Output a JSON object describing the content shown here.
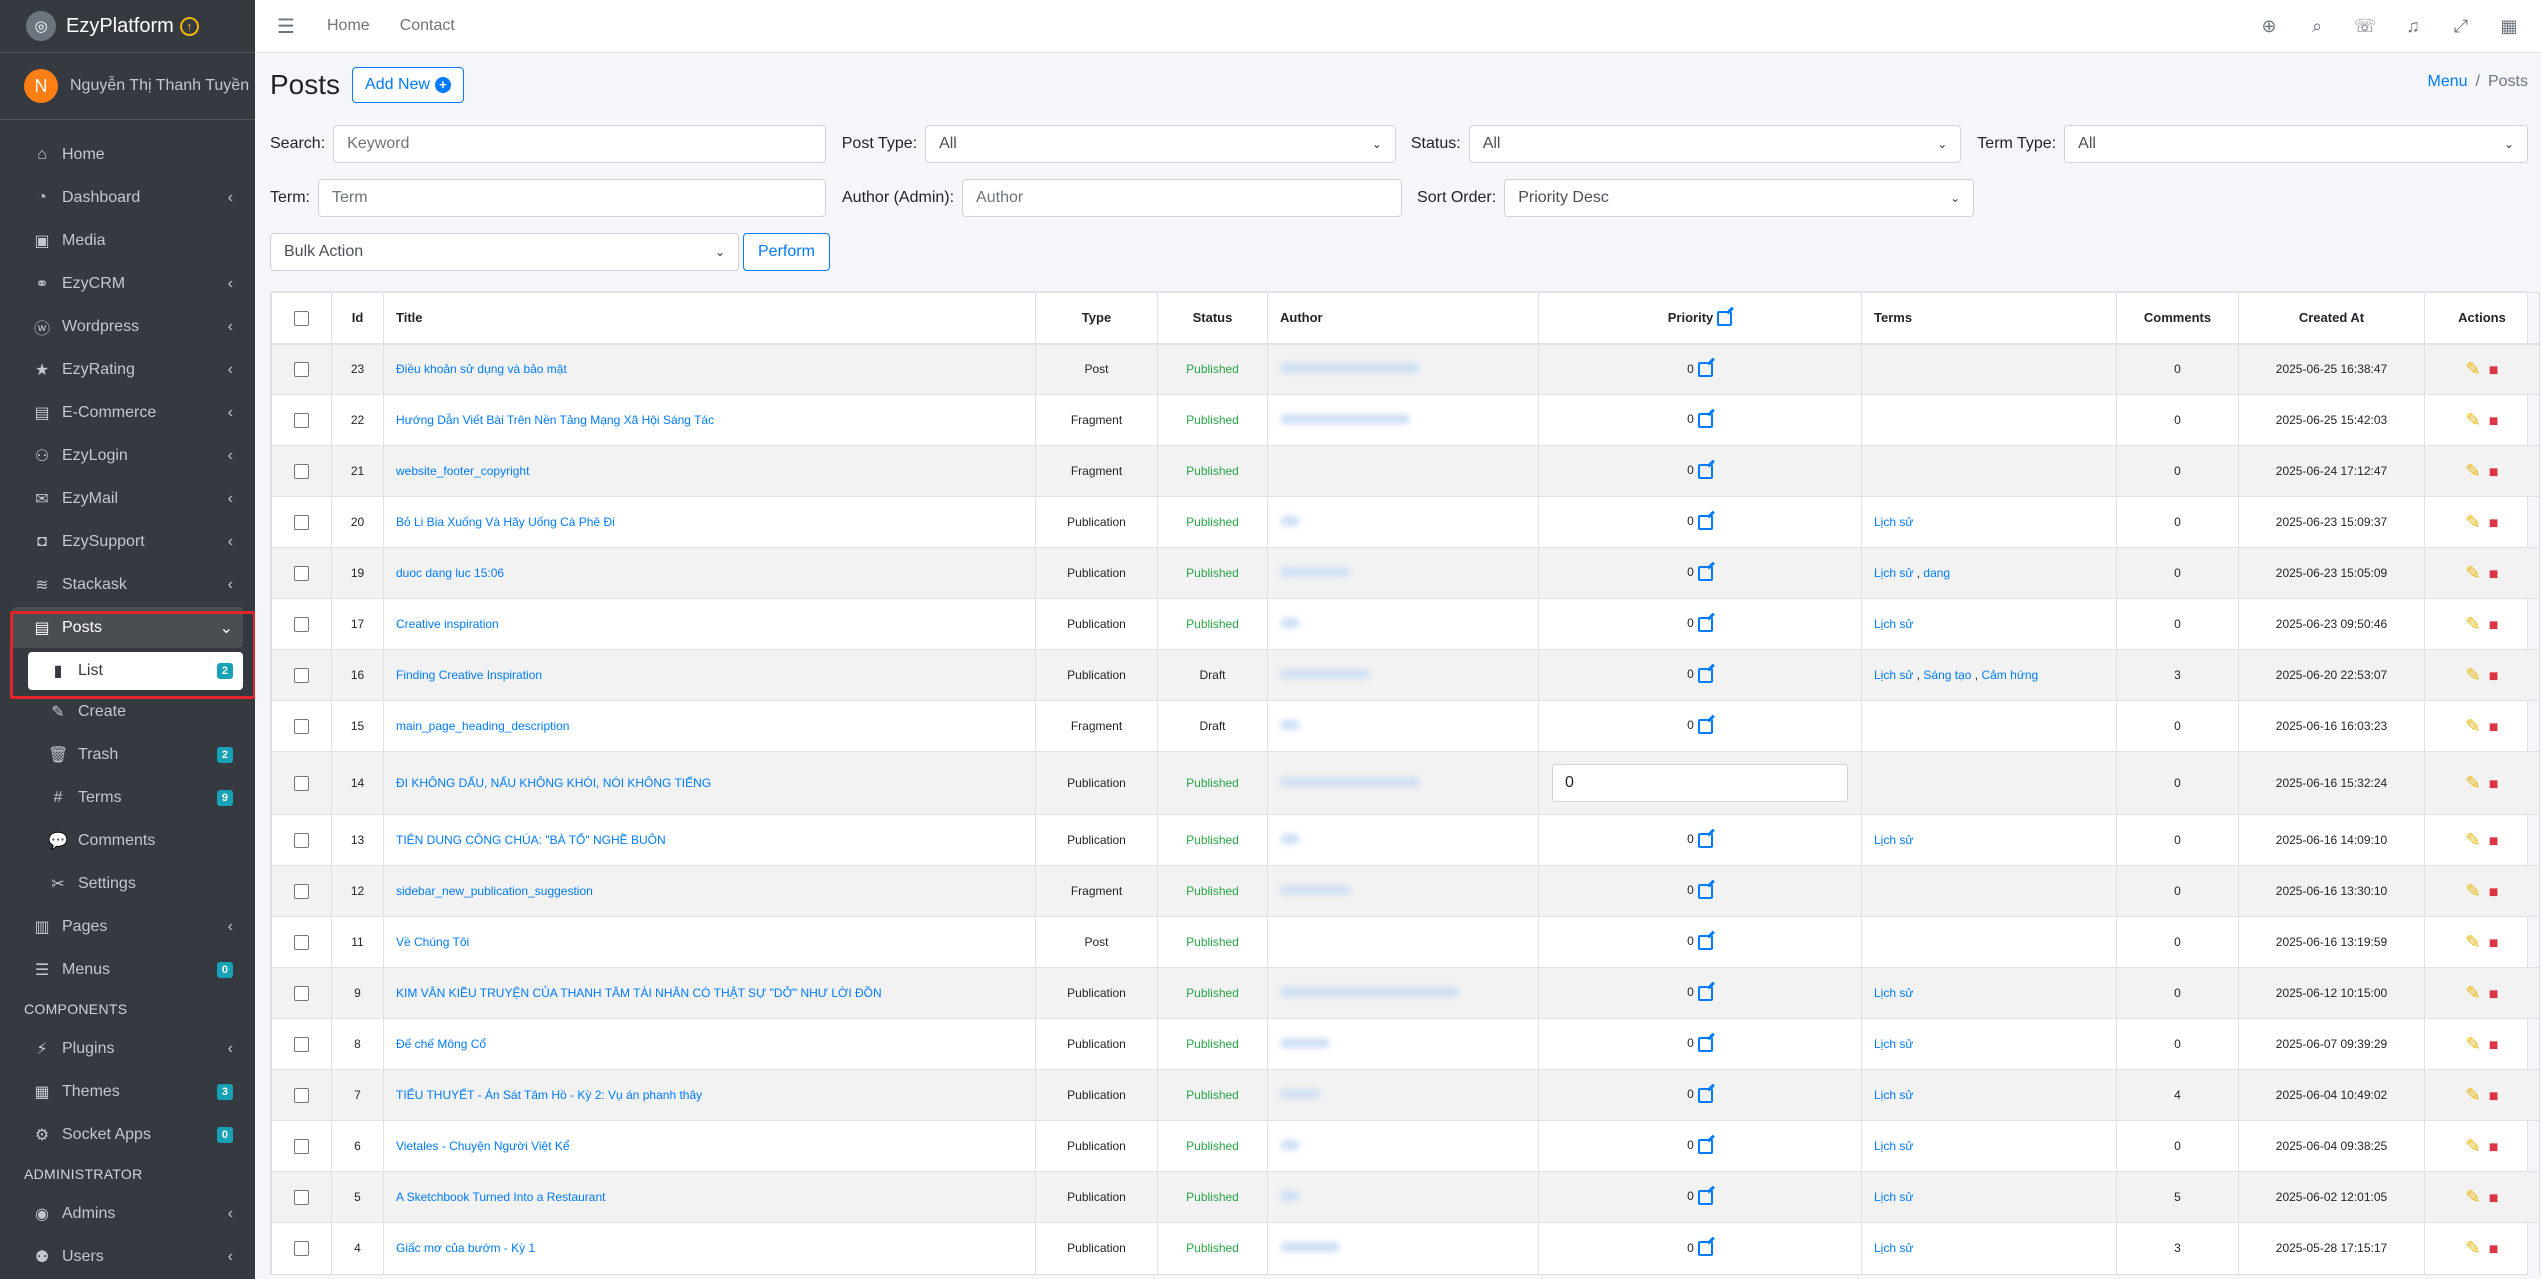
{
  "brand": {
    "name": "EzyPlatform",
    "badge": "↑"
  },
  "user": {
    "initial": "N",
    "name": "Nguyễn Thị Thanh Tuyền"
  },
  "sidebar": {
    "items": [
      {
        "label": "Home",
        "icon": "home-icon",
        "glyph": "⌂",
        "chevron": ""
      },
      {
        "label": "Dashboard",
        "icon": "dashboard-icon",
        "glyph": "◔",
        "chevron": "‹"
      },
      {
        "label": "Media",
        "icon": "image-icon",
        "glyph": "▣",
        "chevron": ""
      },
      {
        "label": "EzyCRM",
        "icon": "handshake-icon",
        "glyph": "⚭",
        "chevron": "‹"
      },
      {
        "label": "Wordpress",
        "icon": "wordpress-icon",
        "glyph": "ⓦ",
        "chevron": "‹"
      },
      {
        "label": "EzyRating",
        "icon": "star-icon",
        "glyph": "★",
        "chevron": "‹"
      },
      {
        "label": "E-Commerce",
        "icon": "shop-icon",
        "glyph": "▤",
        "chevron": "‹"
      },
      {
        "label": "EzyLogin",
        "icon": "user-login-icon",
        "glyph": "⚇",
        "chevron": "‹"
      },
      {
        "label": "EzyMail",
        "icon": "mail-icon",
        "glyph": "✉",
        "chevron": "‹"
      },
      {
        "label": "EzySupport",
        "icon": "support-icon",
        "glyph": "◘",
        "chevron": "‹"
      },
      {
        "label": "Stackask",
        "icon": "layers-icon",
        "glyph": "≋",
        "chevron": "‹"
      }
    ],
    "posts": {
      "label": "Posts",
      "chevron": "⌄"
    },
    "posts_sub": [
      {
        "label": "List",
        "badge": "2",
        "icon": "book-icon",
        "glyph": "▮"
      },
      {
        "label": "Create",
        "badge": "",
        "icon": "edit-icon",
        "glyph": "✎"
      },
      {
        "label": "Trash",
        "badge": "2",
        "icon": "trash-icon",
        "glyph": "🗑"
      },
      {
        "label": "Terms",
        "badge": "9",
        "icon": "hashtag-icon",
        "glyph": "#"
      },
      {
        "label": "Comments",
        "badge": "",
        "icon": "comments-icon",
        "glyph": "💬"
      },
      {
        "label": "Settings",
        "badge": "",
        "icon": "tools-icon",
        "glyph": "✂"
      }
    ],
    "after_posts": [
      {
        "label": "Pages",
        "icon": "book-open-icon",
        "glyph": "▥",
        "chevron": "‹",
        "badge": ""
      },
      {
        "label": "Menus",
        "icon": "menu-icon",
        "glyph": "☰",
        "chevron": "",
        "badge": "0"
      }
    ],
    "components_header": "COMPONENTS",
    "components": [
      {
        "label": "Plugins",
        "icon": "plug-icon",
        "glyph": "⚡",
        "chevron": "‹",
        "badge": ""
      },
      {
        "label": "Themes",
        "icon": "themes-icon",
        "glyph": "▦",
        "chevron": "",
        "badge": "3"
      },
      {
        "label": "Socket Apps",
        "icon": "socket-icon",
        "glyph": "⚙",
        "chevron": "",
        "badge": "0"
      }
    ],
    "admin_header": "ADMINISTRATOR",
    "admin": [
      {
        "label": "Admins",
        "icon": "admin-icon",
        "glyph": "◉",
        "chevron": "‹",
        "badge": ""
      },
      {
        "label": "Users",
        "icon": "users-icon",
        "glyph": "⚉",
        "chevron": "‹",
        "badge": ""
      }
    ]
  },
  "topbar": {
    "home": "Home",
    "contact": "Contact"
  },
  "page": {
    "title": "Posts",
    "add_new": "Add New"
  },
  "breadcrumb": {
    "menu": "Menu",
    "current": "Posts"
  },
  "filters": {
    "search_label": "Search:",
    "search_placeholder": "Keyword",
    "post_type_label": "Post Type:",
    "post_type_value": "All",
    "status_label": "Status:",
    "status_value": "All",
    "term_type_label": "Term Type:",
    "term_type_value": "All",
    "term_label": "Term:",
    "term_placeholder": "Term",
    "author_label": "Author (Admin):",
    "author_placeholder": "Author",
    "sort_label": "Sort Order:",
    "sort_value": "Priority Desc",
    "bulk_value": "Bulk Action",
    "perform": "Perform"
  },
  "table": {
    "headers": {
      "id": "Id",
      "title": "Title",
      "type": "Type",
      "status": "Status",
      "author": "Author",
      "priority": "Priority",
      "terms": "Terms",
      "comments": "Comments",
      "created": "Created At",
      "actions": "Actions"
    },
    "rows": [
      {
        "id": "23",
        "title": "Điều khoản sử dụng và bảo mật",
        "type": "Post",
        "status": "Published",
        "priority": "0",
        "terms": "",
        "comments": "0",
        "created": "2025-06-25 16:38:47"
      },
      {
        "id": "22",
        "title": "Hướng Dẫn Viết Bài Trên Nền Tảng Mạng Xã Hội Sáng Tác",
        "type": "Fragment",
        "status": "Published",
        "priority": "0",
        "terms": "",
        "comments": "0",
        "created": "2025-06-25 15:42:03"
      },
      {
        "id": "21",
        "title": "website_footer_copyright",
        "type": "Fragment",
        "status": "Published",
        "priority": "0",
        "terms": "",
        "comments": "0",
        "created": "2025-06-24 17:12:47"
      },
      {
        "id": "20",
        "title": "Bỏ Li Bia Xuống Và Hãy Uống Cà Phê Đi",
        "type": "Publication",
        "status": "Published",
        "priority": "0",
        "terms": "Lịch sử",
        "comments": "0",
        "created": "2025-06-23 15:09:37"
      },
      {
        "id": "19",
        "title": "duoc dang luc 15:06",
        "type": "Publication",
        "status": "Published",
        "priority": "0",
        "terms": "Lịch sử , dang",
        "comments": "0",
        "created": "2025-06-23 15:05:09"
      },
      {
        "id": "17",
        "title": "Creative inspiration",
        "type": "Publication",
        "status": "Published",
        "priority": "0",
        "terms": "Lịch sử",
        "comments": "0",
        "created": "2025-06-23 09:50:46"
      },
      {
        "id": "16",
        "title": "Finding Creative Inspiration",
        "type": "Publication",
        "status": "Draft",
        "priority": "0",
        "terms": "Lịch sử , Sáng tạo , Cảm hứng",
        "comments": "3",
        "created": "2025-06-20 22:53:07"
      },
      {
        "id": "15",
        "title": "main_page_heading_description",
        "type": "Fragment",
        "status": "Draft",
        "priority": "0",
        "terms": "",
        "comments": "0",
        "created": "2025-06-16 16:03:23"
      },
      {
        "id": "14",
        "title": "ĐI KHÔNG DẤU, NẤU KHÔNG KHÓI, NÓI KHÔNG TIẾNG",
        "type": "Publication",
        "status": "Published",
        "priority": "0",
        "terms": "",
        "comments": "0",
        "created": "2025-06-16 15:32:24",
        "editing": true
      },
      {
        "id": "13",
        "title": "TIÊN DUNG CÔNG CHÚA: \"BÀ TỔ\" NGHỀ BUÔN",
        "type": "Publication",
        "status": "Published",
        "priority": "0",
        "terms": "Lịch sử",
        "comments": "0",
        "created": "2025-06-16 14:09:10"
      },
      {
        "id": "12",
        "title": "sidebar_new_publication_suggestion",
        "type": "Fragment",
        "status": "Published",
        "priority": "0",
        "terms": "",
        "comments": "0",
        "created": "2025-06-16 13:30:10"
      },
      {
        "id": "11",
        "title": "Về Chúng Tôi",
        "type": "Post",
        "status": "Published",
        "priority": "0",
        "terms": "",
        "comments": "0",
        "created": "2025-06-16 13:19:59"
      },
      {
        "id": "9",
        "title": "KIM VÂN KIỀU TRUYỆN CỦA THANH TÂM TÀI NHÂN CÓ THẬT SỰ \"DỞ\" NHƯ LỜI ĐỒN",
        "type": "Publication",
        "status": "Published",
        "priority": "0",
        "terms": "Lịch sử",
        "comments": "0",
        "created": "2025-06-12 10:15:00"
      },
      {
        "id": "8",
        "title": "Đế chế Mông Cổ",
        "type": "Publication",
        "status": "Published",
        "priority": "0",
        "terms": "Lịch sử",
        "comments": "0",
        "created": "2025-06-07 09:39:29"
      },
      {
        "id": "7",
        "title": "TIỂU THUYẾT - Án Sát Tâm Hồ - Kỳ 2: Vụ án phanh thây",
        "type": "Publication",
        "status": "Published",
        "priority": "0",
        "terms": "Lịch sử",
        "comments": "4",
        "created": "2025-06-04 10:49:02"
      },
      {
        "id": "6",
        "title": "Vietales - Chuyện Người Việt Kể",
        "type": "Publication",
        "status": "Published",
        "priority": "0",
        "terms": "Lịch sử",
        "comments": "0",
        "created": "2025-06-04 09:38:25"
      },
      {
        "id": "5",
        "title": "A Sketchbook Turned Into a Restaurant",
        "type": "Publication",
        "status": "Published",
        "priority": "0",
        "terms": "Lịch sử",
        "comments": "5",
        "created": "2025-06-02 12:01:05"
      },
      {
        "id": "4",
        "title": "Giấc mơ của bướm - Kỳ 1",
        "type": "Publication",
        "status": "Published",
        "priority": "0",
        "terms": "Lịch sử",
        "comments": "3",
        "created": "2025-05-28 17:15:17"
      }
    ]
  },
  "colors": {
    "sidebar": "#343a40",
    "accent": "#007bff",
    "published": "#28a745",
    "highlight": "#e3242b"
  }
}
